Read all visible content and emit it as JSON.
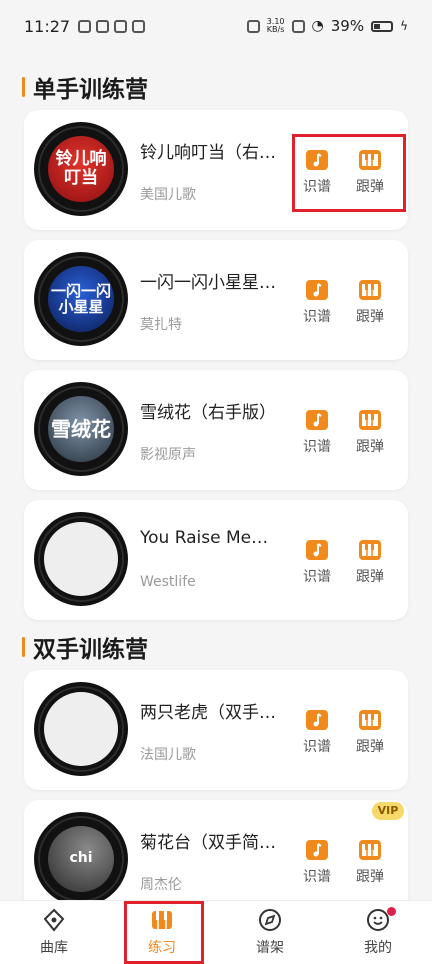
{
  "status_bar": {
    "time": "11:27",
    "net_speed_value": "3.10",
    "net_speed_unit": "KB/s",
    "battery": "39%"
  },
  "sections": [
    {
      "title": "单手训练营",
      "cards": [
        {
          "title": "铃儿响叮当（右…",
          "artist": "美国儿歌",
          "cover_text": "铃儿响叮当"
        },
        {
          "title": "一闪一闪小星星…",
          "artist": "莫扎特",
          "cover_text": "一闪一闪 小星星"
        },
        {
          "title": "雪绒花（右手版）",
          "artist": "影视原声",
          "cover_text": "雪绒花"
        },
        {
          "title": "You Raise Me…",
          "artist": "Westlife",
          "cover_text": ""
        }
      ]
    },
    {
      "title": "双手训练营",
      "cards": [
        {
          "title": "两只老虎（双手…",
          "artist": "法国儿歌",
          "cover_text": ""
        },
        {
          "title": "菊花台（双手简…",
          "artist": "周杰伦",
          "cover_text": "chi"
        }
      ]
    }
  ],
  "actions": {
    "sight_read": "识谱",
    "play_along": "跟弹"
  },
  "vip_badge": "VIP",
  "tabs": [
    {
      "label": "曲库",
      "icon": "music-library-icon"
    },
    {
      "label": "练习",
      "icon": "piano-icon"
    },
    {
      "label": "谱架",
      "icon": "compass-icon"
    },
    {
      "label": "我的",
      "icon": "smile-icon"
    }
  ],
  "colors": {
    "accent": "#f08a1c",
    "highlight": "#e0202c"
  }
}
